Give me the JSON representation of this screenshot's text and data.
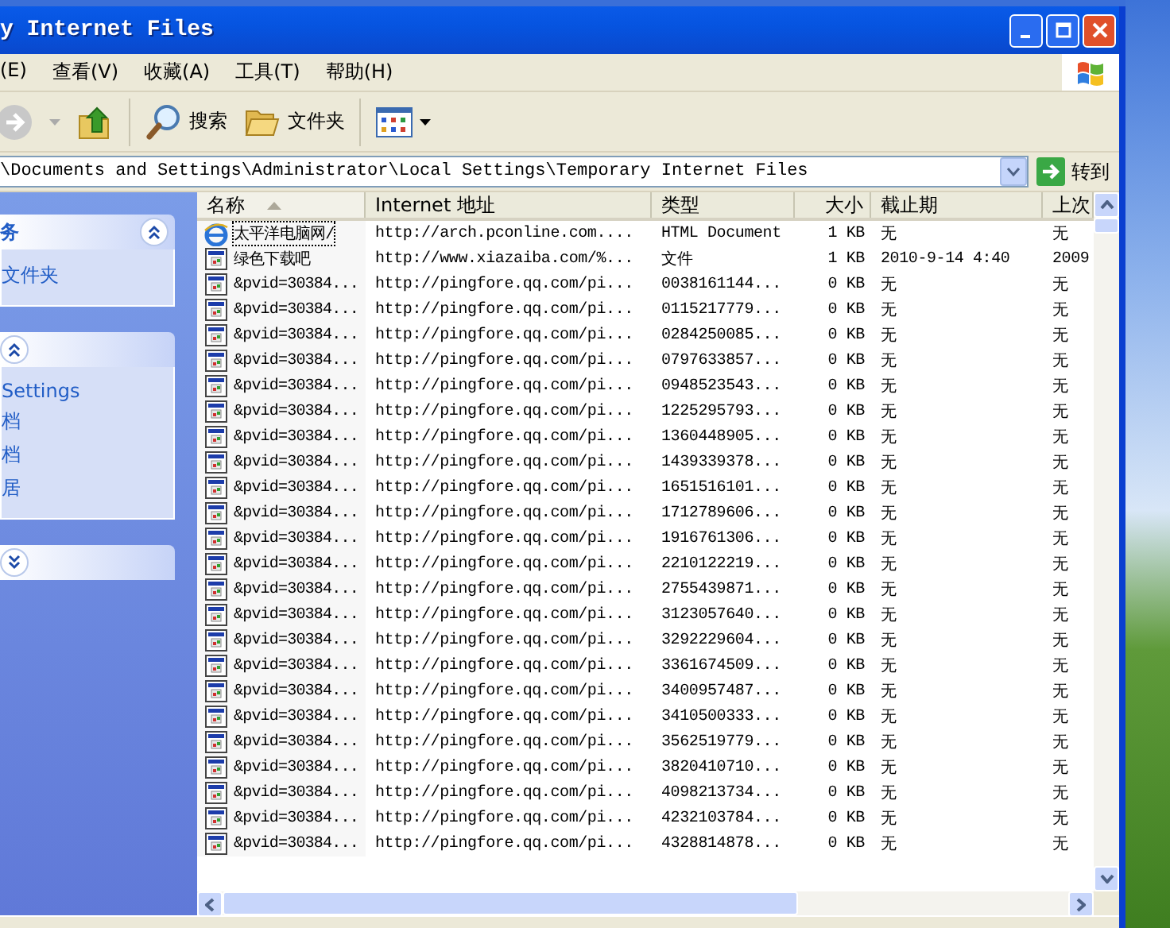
{
  "window": {
    "title": "y Internet Files"
  },
  "menu": [
    {
      "label": "(E)"
    },
    {
      "label": "查看(V)"
    },
    {
      "label": "收藏(A)"
    },
    {
      "label": "工具(T)"
    },
    {
      "label": "帮助(H)"
    }
  ],
  "toolbar": [
    {
      "kind": "forward",
      "disabled": true
    },
    {
      "kind": "up"
    },
    {
      "kind": "search",
      "label": "搜索"
    },
    {
      "kind": "folders",
      "label": "文件夹"
    },
    {
      "kind": "views"
    }
  ],
  "address": {
    "value": "\\Documents and Settings\\Administrator\\Local Settings\\Temporary Internet Files",
    "go_label": "转到"
  },
  "sidebar": {
    "panels": [
      {
        "title": "务",
        "expanded": true,
        "items": [
          "文件夹"
        ]
      },
      {
        "expanded": true,
        "items": [
          "Settings",
          "档",
          "档",
          "居"
        ]
      },
      {
        "expanded": false
      }
    ]
  },
  "table": {
    "columns": [
      {
        "label": "名称",
        "sorted": true
      },
      {
        "label": "Internet 地址",
        "sorted": false
      },
      {
        "label": "类型",
        "sorted": false
      },
      {
        "label": "大小",
        "sorted": false
      },
      {
        "label": "截止期",
        "sorted": false
      },
      {
        "label": "上次",
        "sorted": false
      }
    ],
    "rows": [
      {
        "kind": "ie",
        "focused": true,
        "cells": [
          "太平洋电脑网/",
          "http://arch.pconline.com....",
          "HTML Document",
          "1 KB",
          "无",
          "无"
        ]
      },
      {
        "kind": "page",
        "focused": false,
        "cells": [
          "绿色下载吧",
          "http://www.xiazaiba.com/%...",
          "文件",
          "1 KB",
          "2010-9-14 4:40",
          "2009"
        ]
      },
      {
        "kind": "page",
        "focused": false,
        "cells": [
          "&pvid=30384...",
          "http://pingfore.qq.com/pi...",
          "0038161144...",
          "0 KB",
          "无",
          "无"
        ]
      },
      {
        "kind": "page",
        "focused": false,
        "cells": [
          "&pvid=30384...",
          "http://pingfore.qq.com/pi...",
          "0115217779...",
          "0 KB",
          "无",
          "无"
        ]
      },
      {
        "kind": "page",
        "focused": false,
        "cells": [
          "&pvid=30384...",
          "http://pingfore.qq.com/pi...",
          "0284250085...",
          "0 KB",
          "无",
          "无"
        ]
      },
      {
        "kind": "page",
        "focused": false,
        "cells": [
          "&pvid=30384...",
          "http://pingfore.qq.com/pi...",
          "0797633857...",
          "0 KB",
          "无",
          "无"
        ]
      },
      {
        "kind": "page",
        "focused": false,
        "cells": [
          "&pvid=30384...",
          "http://pingfore.qq.com/pi...",
          "0948523543...",
          "0 KB",
          "无",
          "无"
        ]
      },
      {
        "kind": "page",
        "focused": false,
        "cells": [
          "&pvid=30384...",
          "http://pingfore.qq.com/pi...",
          "1225295793...",
          "0 KB",
          "无",
          "无"
        ]
      },
      {
        "kind": "page",
        "focused": false,
        "cells": [
          "&pvid=30384...",
          "http://pingfore.qq.com/pi...",
          "1360448905...",
          "0 KB",
          "无",
          "无"
        ]
      },
      {
        "kind": "page",
        "focused": false,
        "cells": [
          "&pvid=30384...",
          "http://pingfore.qq.com/pi...",
          "1439339378...",
          "0 KB",
          "无",
          "无"
        ]
      },
      {
        "kind": "page",
        "focused": false,
        "cells": [
          "&pvid=30384...",
          "http://pingfore.qq.com/pi...",
          "1651516101...",
          "0 KB",
          "无",
          "无"
        ]
      },
      {
        "kind": "page",
        "focused": false,
        "cells": [
          "&pvid=30384...",
          "http://pingfore.qq.com/pi...",
          "1712789606...",
          "0 KB",
          "无",
          "无"
        ]
      },
      {
        "kind": "page",
        "focused": false,
        "cells": [
          "&pvid=30384...",
          "http://pingfore.qq.com/pi...",
          "1916761306...",
          "0 KB",
          "无",
          "无"
        ]
      },
      {
        "kind": "page",
        "focused": false,
        "cells": [
          "&pvid=30384...",
          "http://pingfore.qq.com/pi...",
          "2210122219...",
          "0 KB",
          "无",
          "无"
        ]
      },
      {
        "kind": "page",
        "focused": false,
        "cells": [
          "&pvid=30384...",
          "http://pingfore.qq.com/pi...",
          "2755439871...",
          "0 KB",
          "无",
          "无"
        ]
      },
      {
        "kind": "page",
        "focused": false,
        "cells": [
          "&pvid=30384...",
          "http://pingfore.qq.com/pi...",
          "3123057640...",
          "0 KB",
          "无",
          "无"
        ]
      },
      {
        "kind": "page",
        "focused": false,
        "cells": [
          "&pvid=30384...",
          "http://pingfore.qq.com/pi...",
          "3292229604...",
          "0 KB",
          "无",
          "无"
        ]
      },
      {
        "kind": "page",
        "focused": false,
        "cells": [
          "&pvid=30384...",
          "http://pingfore.qq.com/pi...",
          "3361674509...",
          "0 KB",
          "无",
          "无"
        ]
      },
      {
        "kind": "page",
        "focused": false,
        "cells": [
          "&pvid=30384...",
          "http://pingfore.qq.com/pi...",
          "3400957487...",
          "0 KB",
          "无",
          "无"
        ]
      },
      {
        "kind": "page",
        "focused": false,
        "cells": [
          "&pvid=30384...",
          "http://pingfore.qq.com/pi...",
          "3410500333...",
          "0 KB",
          "无",
          "无"
        ]
      },
      {
        "kind": "page",
        "focused": false,
        "cells": [
          "&pvid=30384...",
          "http://pingfore.qq.com/pi...",
          "3562519779...",
          "0 KB",
          "无",
          "无"
        ]
      },
      {
        "kind": "page",
        "focused": false,
        "cells": [
          "&pvid=30384...",
          "http://pingfore.qq.com/pi...",
          "3820410710...",
          "0 KB",
          "无",
          "无"
        ]
      },
      {
        "kind": "page",
        "focused": false,
        "cells": [
          "&pvid=30384...",
          "http://pingfore.qq.com/pi...",
          "4098213734...",
          "0 KB",
          "无",
          "无"
        ]
      },
      {
        "kind": "page",
        "focused": false,
        "cells": [
          "&pvid=30384...",
          "http://pingfore.qq.com/pi...",
          "4232103784...",
          "0 KB",
          "无",
          "无"
        ]
      },
      {
        "kind": "page",
        "focused": false,
        "cells": [
          "&pvid=30384...",
          "http://pingfore.qq.com/pi...",
          "4328814878...",
          "0 KB",
          "无",
          "无"
        ]
      }
    ]
  }
}
